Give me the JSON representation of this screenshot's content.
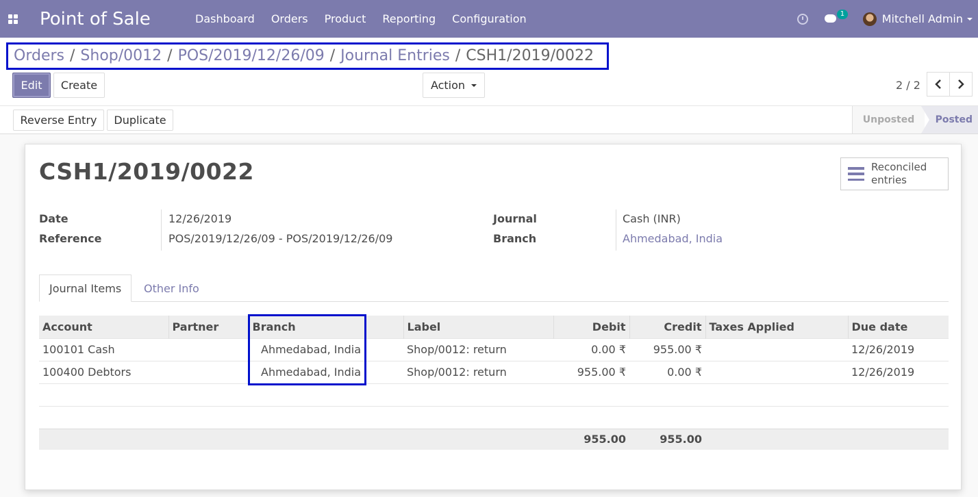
{
  "navbar": {
    "app_title": "Point of Sale",
    "menu": [
      "Dashboard",
      "Orders",
      "Product",
      "Reporting",
      "Configuration"
    ],
    "chat_badge": "1",
    "user_name": "Mitchell Admin"
  },
  "breadcrumb": {
    "items": [
      "Orders",
      "Shop/0012",
      "POS/2019/12/26/09",
      "Journal Entries"
    ],
    "active": "CSH1/2019/0022",
    "separator": "/"
  },
  "buttons": {
    "edit": "Edit",
    "create": "Create",
    "action": "Action",
    "reverse_entry": "Reverse Entry",
    "duplicate": "Duplicate"
  },
  "pager": {
    "text": "2 / 2"
  },
  "statusbar": {
    "unposted": "Unposted",
    "posted": "Posted"
  },
  "form": {
    "title": "CSH1/2019/0022",
    "smart_button": "Reconciled entries",
    "date_label": "Date",
    "date_value": "12/26/2019",
    "reference_label": "Reference",
    "reference_value": "POS/2019/12/26/09 - POS/2019/12/26/09",
    "journal_label": "Journal",
    "journal_value": "Cash (INR)",
    "branch_label": "Branch",
    "branch_value": "Ahmedabad, India"
  },
  "tabs": {
    "journal_items": "Journal Items",
    "other_info": "Other Info"
  },
  "table": {
    "headers": [
      "Account",
      "Partner",
      "Branch",
      "Label",
      "Debit",
      "Credit",
      "Taxes Applied",
      "Due date"
    ],
    "rows": [
      [
        "100101 Cash",
        "",
        "Ahmedabad, India",
        "Shop/0012: return",
        "0.00 ₹",
        "955.00 ₹",
        "",
        "12/26/2019"
      ],
      [
        "100400 Debtors",
        "",
        "Ahmedabad, India",
        "Shop/0012: return",
        "955.00 ₹",
        "0.00 ₹",
        "",
        "12/26/2019"
      ]
    ],
    "total_debit": "955.00",
    "total_credit": "955.00"
  },
  "colors": {
    "brand": "#7c7bad",
    "highlight": "#0011cc"
  }
}
